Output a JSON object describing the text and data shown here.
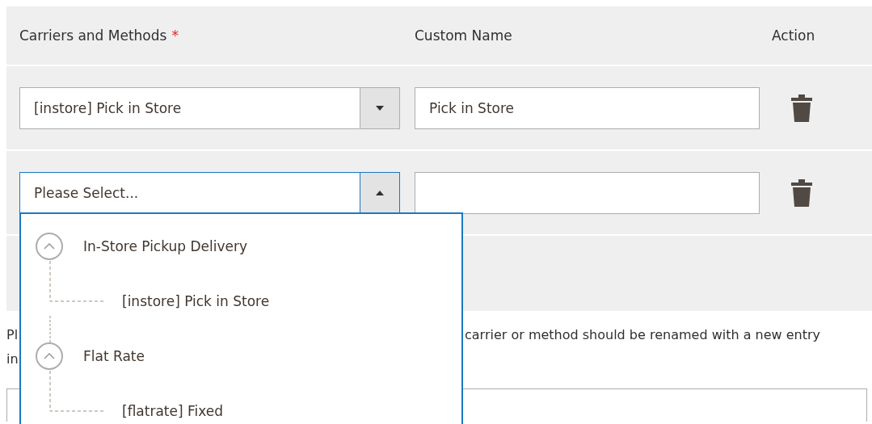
{
  "table": {
    "columns": [
      {
        "label": "Carriers and Methods",
        "required_mark": "*"
      },
      {
        "label": "Custom Name"
      },
      {
        "label": "Action"
      }
    ],
    "rows": [
      {
        "carrier": {
          "value": "[instore] Pick in Store",
          "open": false
        },
        "custom_name": {
          "value": "Pick in Store"
        }
      },
      {
        "carrier": {
          "value": "Please Select...",
          "open": true
        },
        "custom_name": {}
      }
    ]
  },
  "dropdown": {
    "groups": [
      {
        "label": "In-Store Pickup Delivery",
        "expanded": true,
        "children": [
          {
            "label": "[instore] Pick in Store"
          }
        ]
      },
      {
        "label": "Flat Rate",
        "expanded": true,
        "children": [
          {
            "label": "[flatrate] Fixed"
          }
        ]
      }
    ]
  },
  "note": {
    "lines": [
      {
        "left": "Pl",
        "right": "carrier or method should be renamed with a new entry"
      },
      {
        "left": "in"
      }
    ]
  }
}
